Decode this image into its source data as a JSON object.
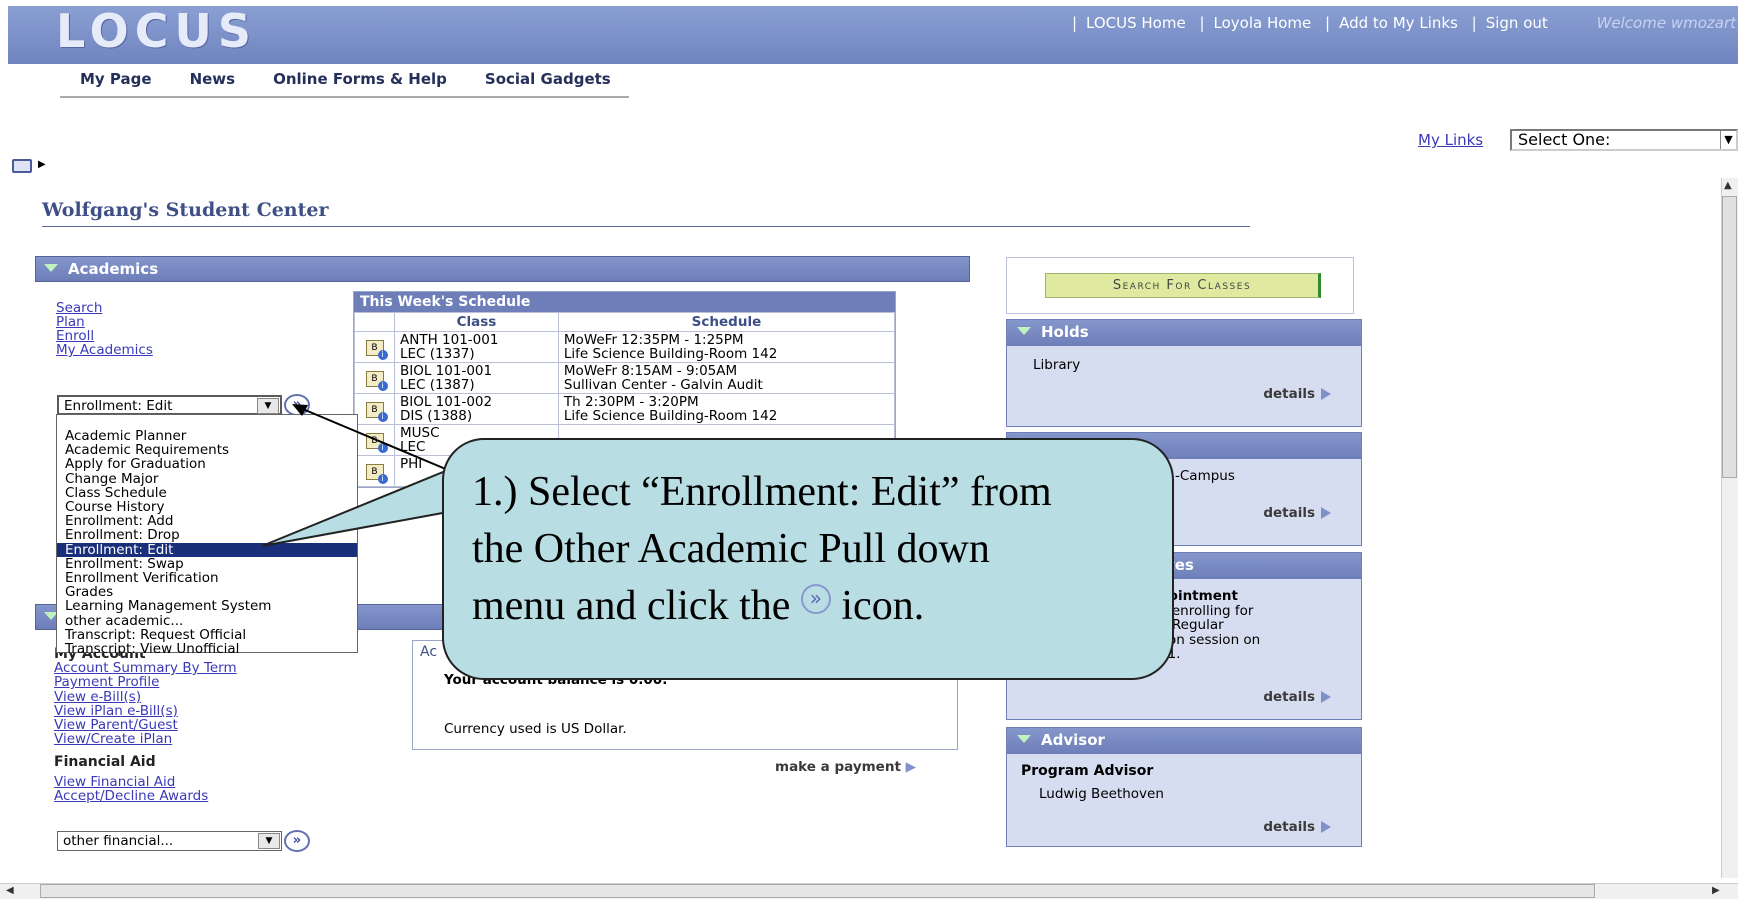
{
  "header": {
    "logo": "LOCUS",
    "links": [
      "LOCUS Home",
      "Loyola Home",
      "Add to My Links",
      "Sign out"
    ],
    "welcome": "Welcome wmozart"
  },
  "tabs": [
    "My Page",
    "News",
    "Online Forms & Help",
    "Social Gadgets"
  ],
  "my_links": {
    "label": "My Links",
    "value": "Select One:"
  },
  "page_title": "Wolfgang's Student Center",
  "academics": {
    "title": "Academics",
    "links": [
      "Search",
      "Plan",
      "Enroll",
      "My Academics"
    ],
    "select_value": "Enrollment: Edit",
    "dropdown_options": [
      "Academic Planner",
      "Academic Requirements",
      "Apply for Graduation",
      "Change Major",
      "Class Schedule",
      "Course History",
      "Enrollment: Add",
      "Enrollment: Drop",
      "Enrollment: Edit",
      "Enrollment: Swap",
      "Enrollment Verification",
      "Grades",
      "Learning Management System",
      "other academic...",
      "Transcript: Request Official",
      "Transcript: View Unofficial"
    ],
    "selected_option": "Enrollment: Edit"
  },
  "schedule": {
    "title": "This Week's Schedule",
    "headers": [
      "Class",
      "Schedule"
    ],
    "rows": [
      {
        "cls1": "ANTH 101-001",
        "cls2": "LEC (1337)",
        "s1": "MoWeFr 12:35PM - 1:25PM",
        "s2": "Life Science Building-Room 142"
      },
      {
        "cls1": "BIOL 101-001",
        "cls2": "LEC (1387)",
        "s1": "MoWeFr 8:15AM - 9:05AM",
        "s2": "Sullivan Center - Galvin Audit"
      },
      {
        "cls1": "BIOL 101-002",
        "cls2": "DIS (1388)",
        "s1": "Th 2:30PM - 3:20PM",
        "s2": "Life Science Building-Room 142"
      },
      {
        "cls1": "MUSC",
        "cls2": "LEC",
        "s1": "",
        "s2": ""
      },
      {
        "cls1": "PHI",
        "cls2": "",
        "s1": "",
        "s2": ""
      }
    ]
  },
  "finances": {
    "my_account_heading": "My Account",
    "account_links": [
      "Account Summary By Term",
      "Payment Profile",
      "View e-Bill(s)",
      "View iPlan e-Bill(s)",
      "View Parent/Guest",
      "View/Create iPlan"
    ],
    "financial_aid_heading": "Financial Aid",
    "aid_links": [
      "View Financial Aid",
      "Accept/Decline Awards"
    ],
    "account_box_heading": "Ac",
    "balance_text": "Your account balance is 0.00.",
    "currency_text": "Currency used is US Dollar.",
    "make_payment": "make a payment",
    "select_value": "other financial..."
  },
  "right": {
    "search_button": "Search For Classes",
    "holds": {
      "title": "Holds",
      "item": "Library",
      "details": "details"
    },
    "todo": {
      "item": "-Campus",
      "details": "details"
    },
    "dates": {
      "title": "Dates",
      "line1": "pointment",
      "line2": "n enrolling for",
      "line3": "2 Regular",
      "line4": "tion session on",
      "line5": "11.",
      "details": "details"
    },
    "advisor": {
      "title": "Advisor",
      "role": "Program Advisor",
      "name": "Ludwig Beethoven",
      "details": "details"
    }
  },
  "callout": {
    "line1": "1.) Select “Enrollment: Edit” from",
    "line2": "the Other  Academic Pull down",
    "line3a": "menu and click the",
    "line3b": "icon."
  },
  "icons": {
    "go": "double-chevron-right-icon",
    "arrow_color": "#000000"
  }
}
